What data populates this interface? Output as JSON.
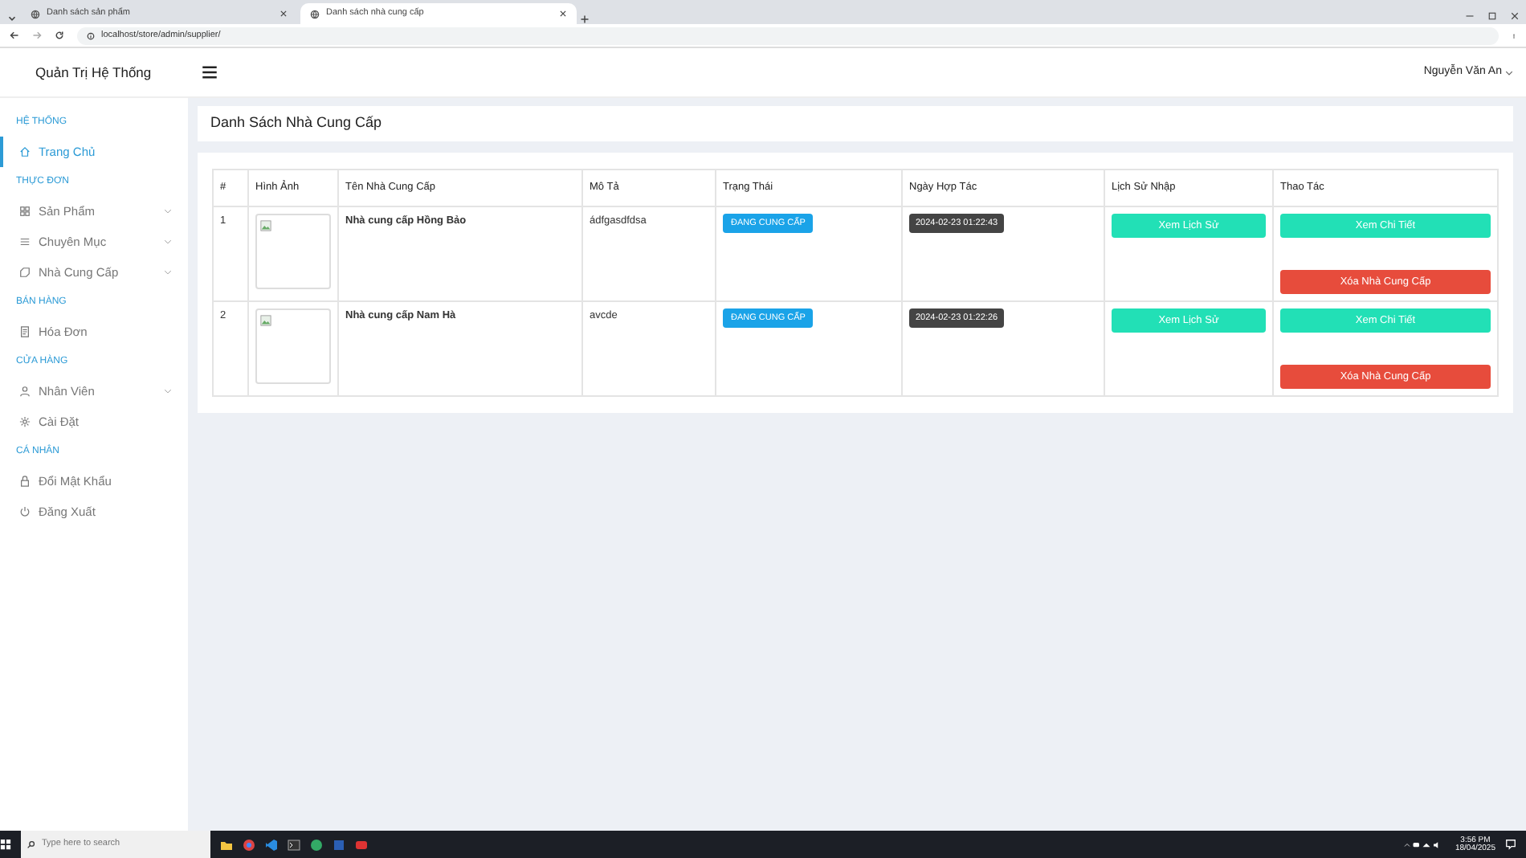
{
  "browser": {
    "tabs": [
      {
        "title": "Danh sách sản phẩm",
        "selected": false
      },
      {
        "title": "Danh sách nhà cung cấp",
        "selected": true
      }
    ],
    "url": "localhost/store/admin/supplier/"
  },
  "header": {
    "brand": "Quản Trị Hệ Thống",
    "user": "Nguyễn Văn An"
  },
  "sidebar": [
    {
      "heading": "HỆ THỐNG",
      "items": [
        {
          "label": "Trang Chủ",
          "kind": "home",
          "selected": true,
          "expandable": false
        }
      ]
    },
    {
      "heading": "THỰC ĐƠN",
      "items": [
        {
          "label": "Sản Phẩm",
          "kind": "grid",
          "selected": false,
          "expandable": true
        },
        {
          "label": "Chuyên Mục",
          "kind": "list",
          "selected": false,
          "expandable": true
        },
        {
          "label": "Nhà Cung Cấp",
          "kind": "tag",
          "selected": false,
          "expandable": true
        }
      ]
    },
    {
      "heading": "BÁN HÀNG",
      "items": [
        {
          "label": "Hóa Đơn",
          "kind": "receipt",
          "selected": false,
          "expandable": false
        }
      ]
    },
    {
      "heading": "CỬA HÀNG",
      "items": [
        {
          "label": "Nhân Viên",
          "kind": "user",
          "selected": false,
          "expandable": true
        },
        {
          "label": "Cài Đặt",
          "kind": "gear",
          "selected": false,
          "expandable": false
        }
      ]
    },
    {
      "heading": "CÁ NHÂN",
      "items": [
        {
          "label": "Đổi Mật Khẩu",
          "kind": "lock",
          "selected": false,
          "expandable": false
        },
        {
          "label": "Đăng Xuất",
          "kind": "power",
          "selected": false,
          "expandable": false
        }
      ]
    }
  ],
  "page_title": "Danh Sách Nhà Cung Cấp",
  "table": {
    "columns": [
      "#",
      "Hình Ảnh",
      "Tên Nhà Cung Cấp",
      "Mô Tả",
      "Trạng Thái",
      "Ngày Hợp Tác",
      "Lịch Sử Nhập",
      "Thao Tác"
    ],
    "rows": [
      {
        "index": "1",
        "name": "Nhà cung cấp Hồng Bảo",
        "description": "ádfgasdfdsa",
        "status": "ĐANG CUNG CẤP",
        "date": "2024-02-23 01:22:43",
        "history_button": "Xem Lịch Sử",
        "detail_button": "Xem Chi Tiết",
        "delete_button": "Xóa Nhà Cung Cấp"
      },
      {
        "index": "2",
        "name": "Nhà cung cấp Nam Hà",
        "description": "avcde",
        "status": "ĐANG CUNG CẤP",
        "date": "2024-02-23 01:22:26",
        "history_button": "Xem Lịch Sử",
        "detail_button": "Xem Chi Tiết",
        "delete_button": "Xóa Nhà Cung Cấp"
      }
    ]
  },
  "taskbar": {
    "search_placeholder": "Type here to search",
    "time": "3:56 PM",
    "date": "18/04/2025"
  }
}
